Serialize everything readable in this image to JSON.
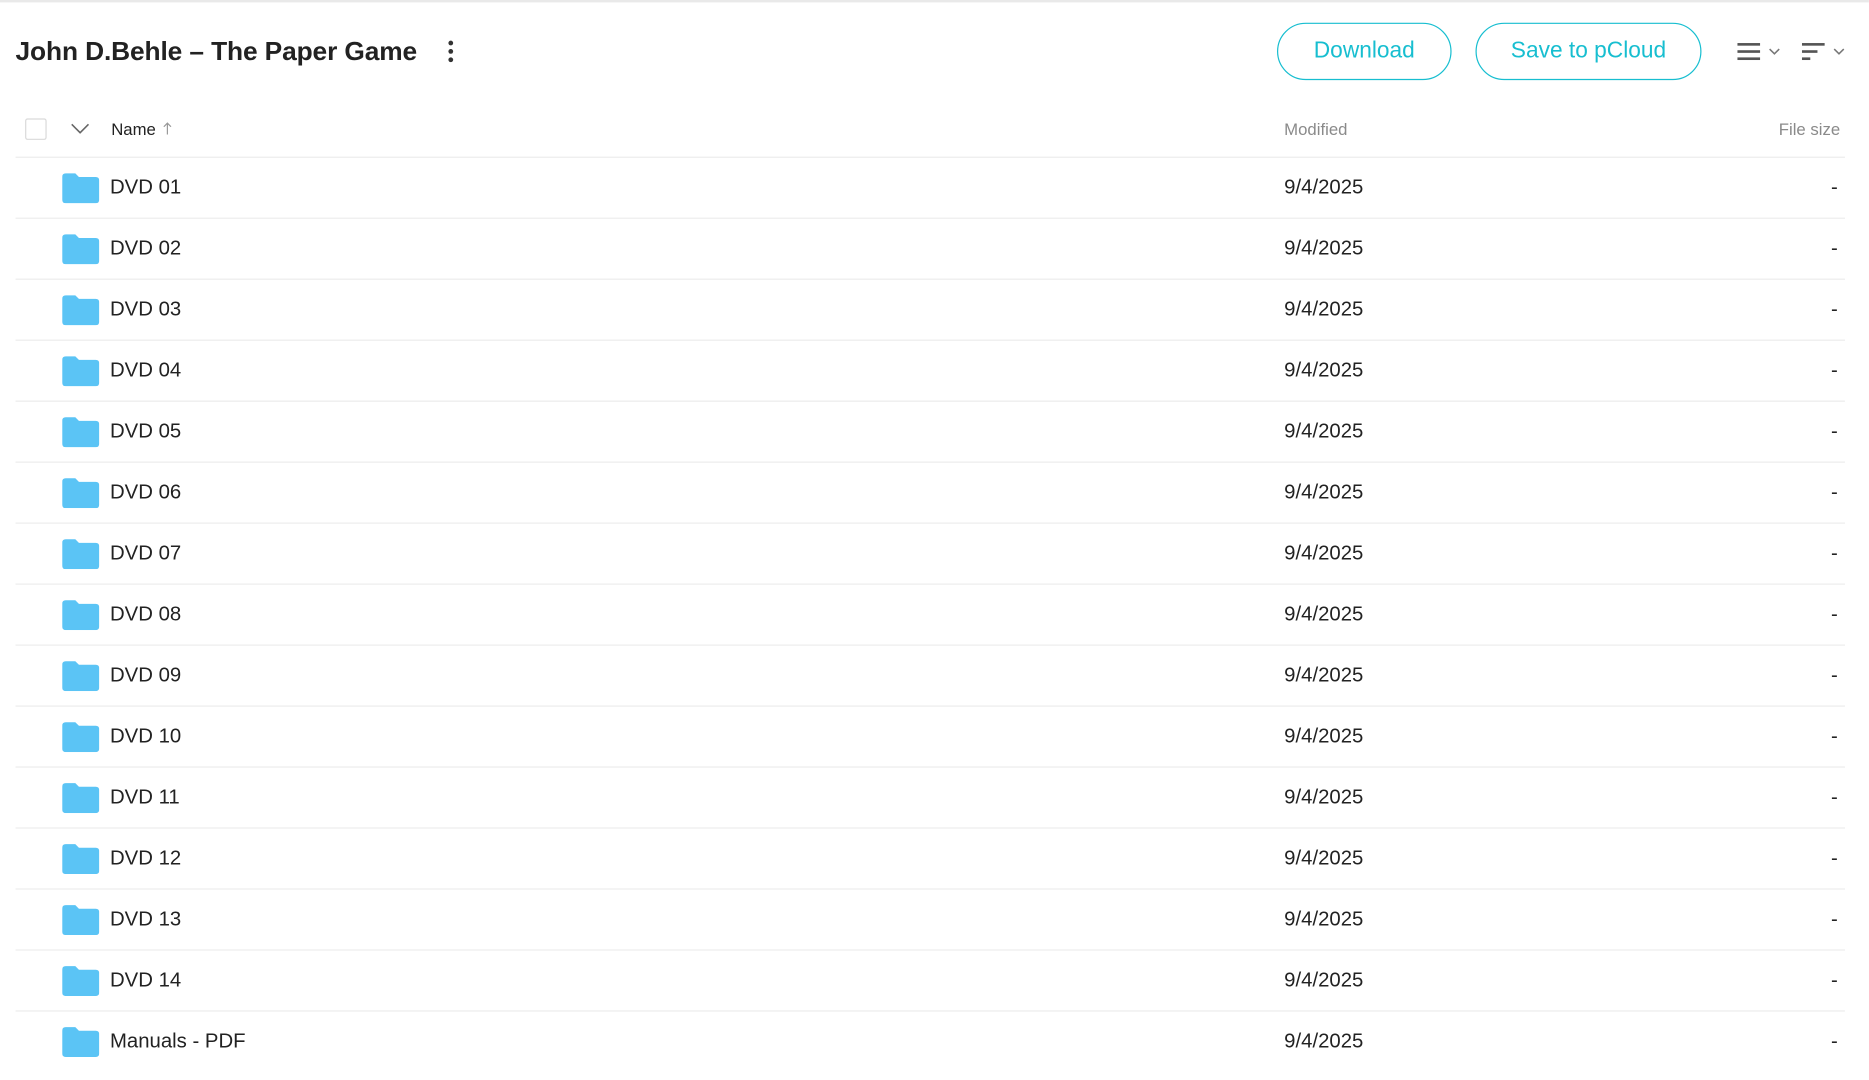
{
  "header": {
    "title": "John D.Behle – The Paper Game",
    "download_label": "Download",
    "save_label": "Save to pCloud"
  },
  "colors": {
    "accent": "#17bed0",
    "folder": "#5bc4f5",
    "text": "#222222",
    "muted": "#8a8a8a"
  },
  "icons": {
    "more": "more-vertical-icon",
    "view": "list-view-icon",
    "sort": "sort-lines-icon",
    "chevron": "chevron-down-icon",
    "sort_arrow": "arrow-up-icon",
    "folder": "folder-icon"
  },
  "table": {
    "columns": {
      "name": "Name",
      "modified": "Modified",
      "size": "File size"
    },
    "rows": [
      {
        "name": "DVD 01",
        "modified": "9/4/2025",
        "size": "-"
      },
      {
        "name": "DVD 02",
        "modified": "9/4/2025",
        "size": "-"
      },
      {
        "name": "DVD 03",
        "modified": "9/4/2025",
        "size": "-"
      },
      {
        "name": "DVD 04",
        "modified": "9/4/2025",
        "size": "-"
      },
      {
        "name": "DVD 05",
        "modified": "9/4/2025",
        "size": "-"
      },
      {
        "name": "DVD 06",
        "modified": "9/4/2025",
        "size": "-"
      },
      {
        "name": "DVD 07",
        "modified": "9/4/2025",
        "size": "-"
      },
      {
        "name": "DVD 08",
        "modified": "9/4/2025",
        "size": "-"
      },
      {
        "name": "DVD 09",
        "modified": "9/4/2025",
        "size": "-"
      },
      {
        "name": "DVD 10",
        "modified": "9/4/2025",
        "size": "-"
      },
      {
        "name": "DVD 11",
        "modified": "9/4/2025",
        "size": "-"
      },
      {
        "name": "DVD 12",
        "modified": "9/4/2025",
        "size": "-"
      },
      {
        "name": "DVD 13",
        "modified": "9/4/2025",
        "size": "-"
      },
      {
        "name": "DVD 14",
        "modified": "9/4/2025",
        "size": "-"
      },
      {
        "name": "Manuals - PDF",
        "modified": "9/4/2025",
        "size": "-"
      }
    ]
  }
}
